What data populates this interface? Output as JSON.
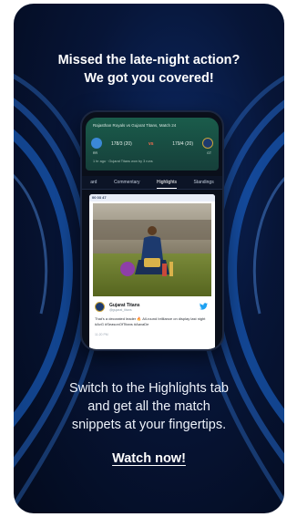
{
  "headline": {
    "line1": "Missed the late-night action?",
    "line2": "We got you covered!"
  },
  "match": {
    "title": "Rajasthan Royals vs Gujarat Titans, Match 24",
    "team1": {
      "abbr": "RR",
      "score": "178/3 (20)"
    },
    "team2": {
      "abbr": "GT",
      "score": "179/4 (20)"
    },
    "vs": "vs",
    "result": "1 hr ago · Gujarat Titans won by 3 runs"
  },
  "tabs": [
    "ard",
    "Commentary",
    "Highlights",
    "Standings"
  ],
  "active_tab": "Highlights",
  "highlight": {
    "time": "00 03 47",
    "tweet_name": "Gujarat Titans",
    "tweet_handle": "@gujarat_titans",
    "tweet_text": "That's a decorated leader 🔥 All-round brilliance on display last night #AvG #SeasonOfTitans #AavaDe",
    "tweet_time": "11:20 PM"
  },
  "body": {
    "line1": "Switch to the Highlights tab",
    "line2": "and get all the match",
    "line3": "snippets at your fingertips."
  },
  "cta_label": "Watch now!",
  "colors": {
    "background_dark": "#030a1c",
    "swirl_blue": "#1e6fe0",
    "score_card_green": "#1a5c4b",
    "vs_orange": "#f26b4f",
    "twitter_blue": "#1da1f2"
  }
}
